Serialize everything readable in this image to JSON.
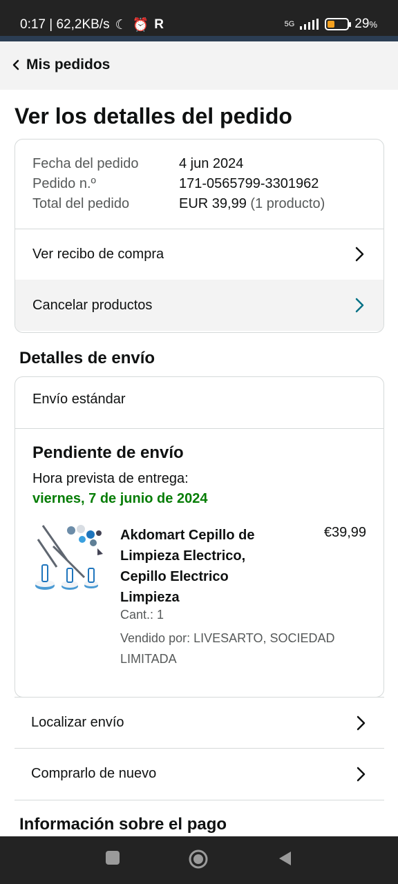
{
  "status_bar": {
    "time_speed": "0:17 | 62,2KB/s",
    "network": "5G",
    "battery": "29",
    "battery_unit": "%"
  },
  "nav": {
    "back_label": "Mis pedidos"
  },
  "page": {
    "title": "Ver los detalles del pedido"
  },
  "order_summary": {
    "date_label": "Fecha del pedido",
    "date_value": "4 jun 2024",
    "order_no_label": "Pedido n.º",
    "order_no_value": "171-0565799-3301962",
    "total_label": "Total del pedido",
    "total_value": "EUR 39,99",
    "total_note": "(1 producto)"
  },
  "actions": {
    "receipt": "Ver recibo de compra",
    "cancel": "Cancelar productos"
  },
  "shipping": {
    "section_title": "Detalles de envío",
    "method": "Envío estándar",
    "status": "Pendiente de envío",
    "eta_label": "Hora prevista de entrega:",
    "eta_date": "viernes, 7 de junio de 2024",
    "product": {
      "name": "Akdomart Cepillo de Limpieza Electrico, Cepillo Electrico Limpieza",
      "price": "€39,99",
      "quantity": "Cant.: 1",
      "seller": "Vendido por: LIVESARTO, SOCIEDAD LIMITADA"
    }
  },
  "more_actions": {
    "track": "Localizar envío",
    "buy_again": "Comprarlo de nuevo"
  },
  "payment": {
    "section_title": "Información sobre el pago"
  },
  "icons": {
    "moon": "moon-icon",
    "alarm": "alarm-icon",
    "r": "r-icon",
    "signal": "signal-icon",
    "battery": "battery-icon",
    "back": "chevron-left-icon",
    "chevron": "chevron-right-icon",
    "home": "home-icon",
    "recents": "recents-icon",
    "back_nav": "back-icon"
  },
  "colors": {
    "accent_teal": "#007185",
    "success_green": "#067d06",
    "status_bar": "#232323",
    "nav_bg": "#f3f3f3"
  }
}
